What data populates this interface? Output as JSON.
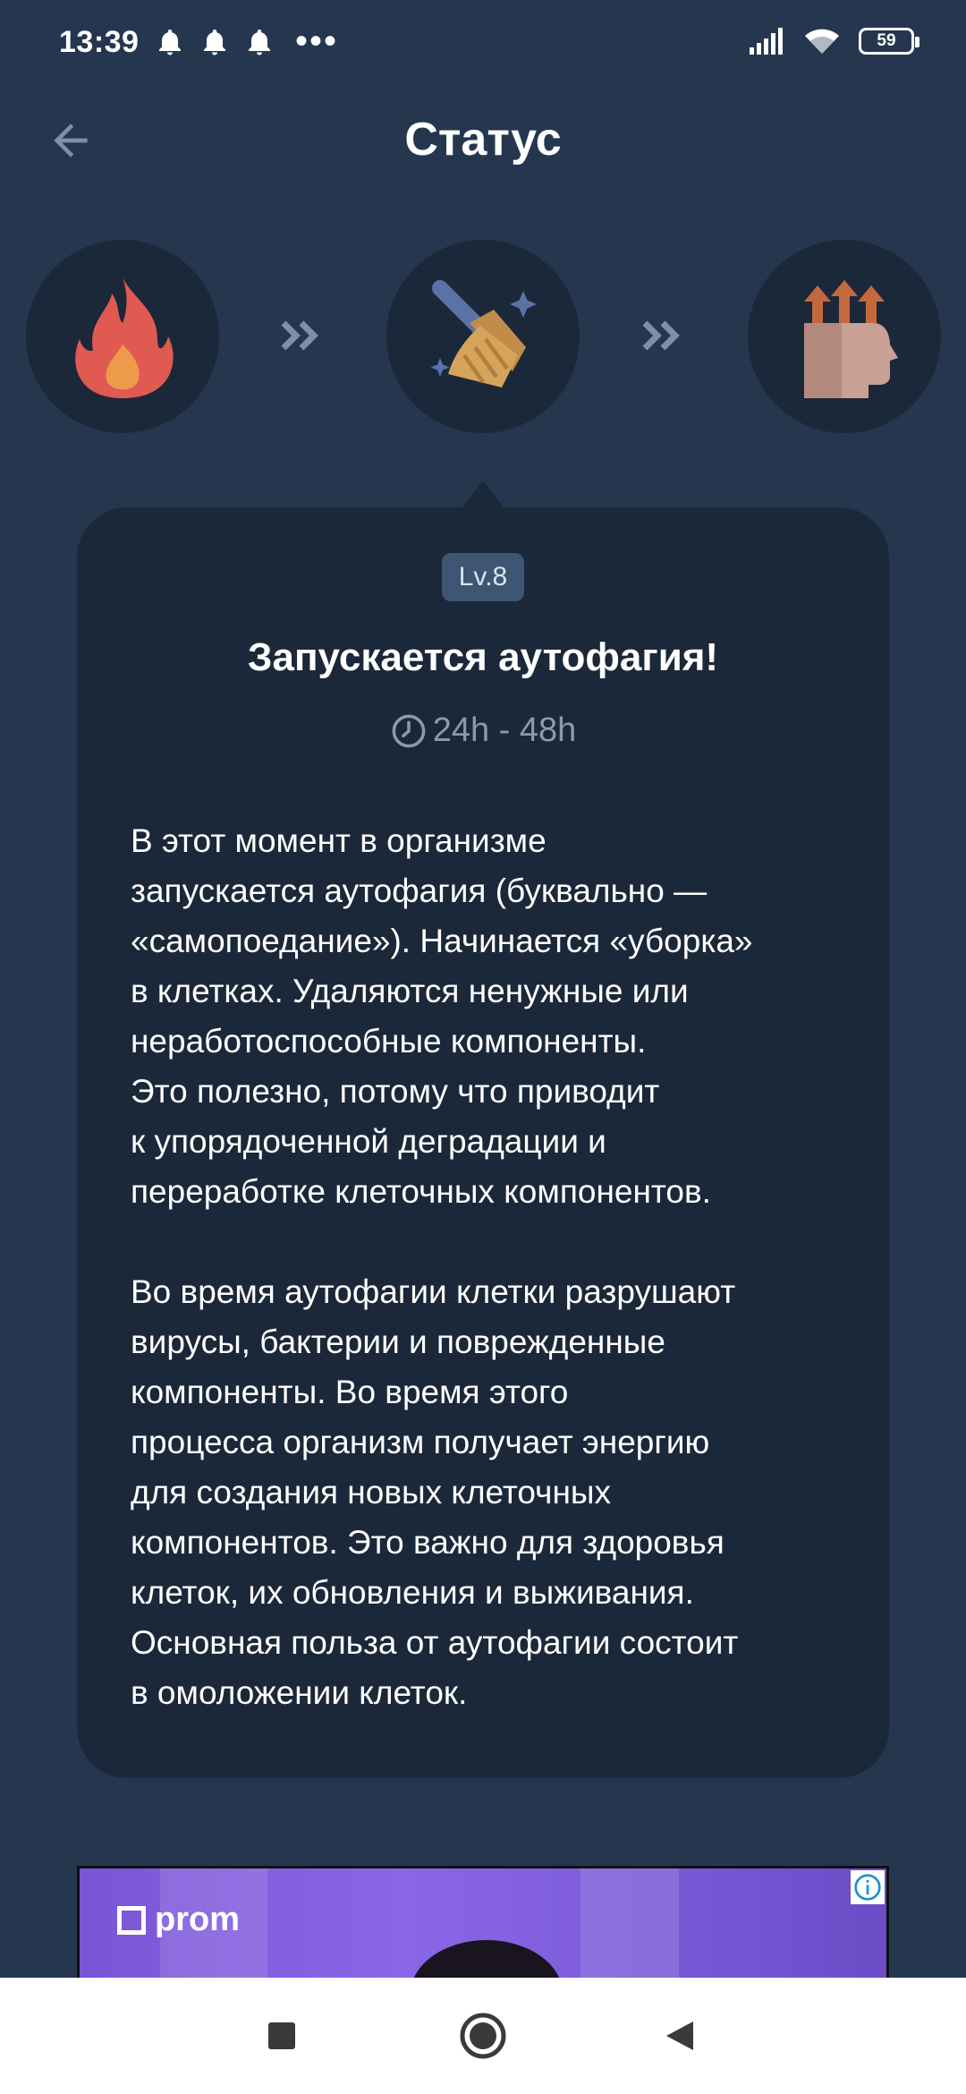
{
  "status_bar": {
    "time": "13:39",
    "battery": "59",
    "notification_icons": [
      "bell-icon",
      "bell-icon",
      "bell-icon"
    ],
    "overflow": "•••"
  },
  "header": {
    "title": "Статус",
    "back_icon": "arrow-left-icon"
  },
  "stages": [
    {
      "icon": "fire-icon",
      "state": "past"
    },
    {
      "icon": "broom-icon",
      "state": "current"
    },
    {
      "icon": "head-growth-icon",
      "state": "next"
    }
  ],
  "separator_icon": "double-chevron-right-icon",
  "card": {
    "level": "Lv.8",
    "title": "Запускается аутофагия!",
    "duration": "24h - 48h",
    "paragraph_1": "В этот момент в организме\nзапускается аутофагия (буквально —\n«самопоедание»). Начинается «уборка»\nв клетках. Удаляются ненужные или\nнеработоспособные компоненты.\nЭто полезно, потому что приводит\nк упорядоченной деградации и\nпереработке клеточных компонентов.",
    "paragraph_2": "Во время аутофагии клетки разрушают\nвирусы, бактерии и поврежденные\nкомпоненты. Во время этого\nпроцесса организм получает энергию\nдля создания новых клеточных\nкомпонентов. Это важно для здоровья\nклеток, их обновления и выживания.\nОсновная польза от аутофагии состоит\nв омоложении клеток."
  },
  "ad": {
    "brand": "prom",
    "info_icon": "info-icon"
  },
  "colors": {
    "background": "#25374f",
    "card": "#1b2839",
    "badge": "#3e5573",
    "muted_text": "#8e9aab",
    "fire": "#e05a52",
    "broom_handle": "#5a72a8",
    "broom_bristles": "#d6a35b",
    "head": "#c8a094"
  },
  "nav_bar": {
    "recent_icon": "square-icon",
    "home_icon": "circle-home-icon",
    "back_icon": "triangle-back-icon"
  }
}
